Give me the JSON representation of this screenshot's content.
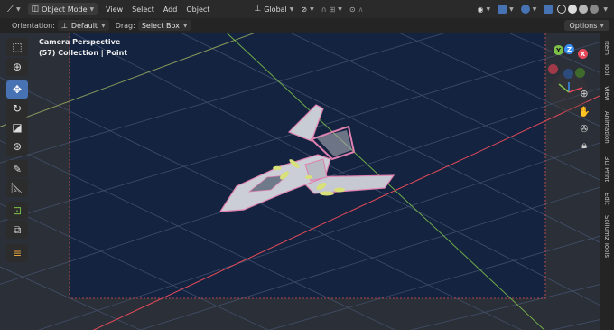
{
  "header": {
    "mode_label": "Object Mode",
    "menus": [
      "View",
      "Select",
      "Add",
      "Object"
    ],
    "transform_orientation": "Global"
  },
  "toolbar2": {
    "orientation_label": "Orientation:",
    "orientation_value": "Default",
    "drag_label": "Drag:",
    "drag_value": "Select Box",
    "options_label": "Options"
  },
  "viewport": {
    "camera_title": "Camera Perspective",
    "collection_info": "(57) Collection | Point"
  },
  "gizmo": {
    "x": "X",
    "y": "Y",
    "z": "Z"
  },
  "sidebar_tabs": [
    "Item",
    "Tool",
    "View",
    "Animation",
    "3D Print",
    "Edit",
    "Sollumz Tools"
  ],
  "tools": [
    "select-box-icon",
    "cursor-icon",
    "move-icon",
    "rotate-icon",
    "scale-icon",
    "transform-icon",
    "annotate-icon",
    "measure-icon",
    "add-cube-icon",
    "extrude-icon",
    "grease-pencil-icon"
  ],
  "colors": {
    "accent": "#4772b3",
    "camera_frame": "#e05050",
    "x_axis": "#e44a5a",
    "y_axis": "#7ec04a",
    "z_axis": "#3a8ef0",
    "viewport_inner": "#142440"
  }
}
